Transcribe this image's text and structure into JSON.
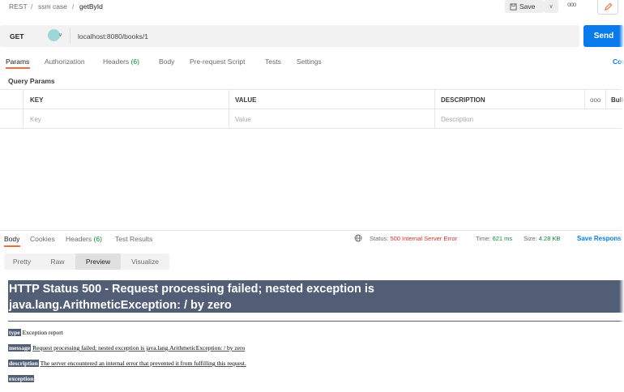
{
  "breadcrumb": {
    "items": [
      "REST",
      "ssm case",
      "getById"
    ],
    "separator": "/"
  },
  "toolbar": {
    "save_label": "Save",
    "more": "ooo"
  },
  "request": {
    "method": "GET",
    "url": "localhost:8080/books/1",
    "send_label": "Send"
  },
  "request_tabs": [
    {
      "label": "Params"
    },
    {
      "label": "Authorization"
    },
    {
      "label": "Headers",
      "count": "(6)"
    },
    {
      "label": "Body"
    },
    {
      "label": "Pre-request Script"
    },
    {
      "label": "Tests"
    },
    {
      "label": "Settings"
    }
  ],
  "cookies_link": "Coo",
  "query_params": {
    "title": "Query Params",
    "headers": [
      "KEY",
      "VALUE",
      "DESCRIPTION"
    ],
    "more": "ooo",
    "bulk_edit": "Bulk",
    "placeholders": [
      "Key",
      "Value",
      "Description"
    ]
  },
  "response_tabs": [
    {
      "label": "Body"
    },
    {
      "label": "Cookies"
    },
    {
      "label": "Headers",
      "count": "(6)"
    },
    {
      "label": "Test Results"
    }
  ],
  "response_status": {
    "status_label": "Status:",
    "status_value": "500 Internal Server Error",
    "time_label": "Time:",
    "time_value": "621 ms",
    "size_label": "Size:",
    "size_value": "4.28 KB"
  },
  "save_response": "Save Respons",
  "view_modes": [
    "Pretty",
    "Raw",
    "Preview",
    "Visualize"
  ],
  "preview": {
    "heading_line1": "HTTP Status 500 - Request processing failed; nested exception is",
    "heading_line2": "java.lang.ArithmeticException: / by zero",
    "type_label": "type",
    "type_text": "Exception report",
    "message_label": "message",
    "message_text": "Request processing failed; nested exception is java.lang.ArithmeticException: / by zero",
    "description_label": "description",
    "description_text": "The server encountered an internal error that prevented it from fulfilling this request.",
    "exception_label": "exception"
  },
  "colors": {
    "accent": "#f26b3a",
    "send": "#097bed",
    "error_status": "#d93025",
    "tomcat_banner": "#525d76"
  }
}
